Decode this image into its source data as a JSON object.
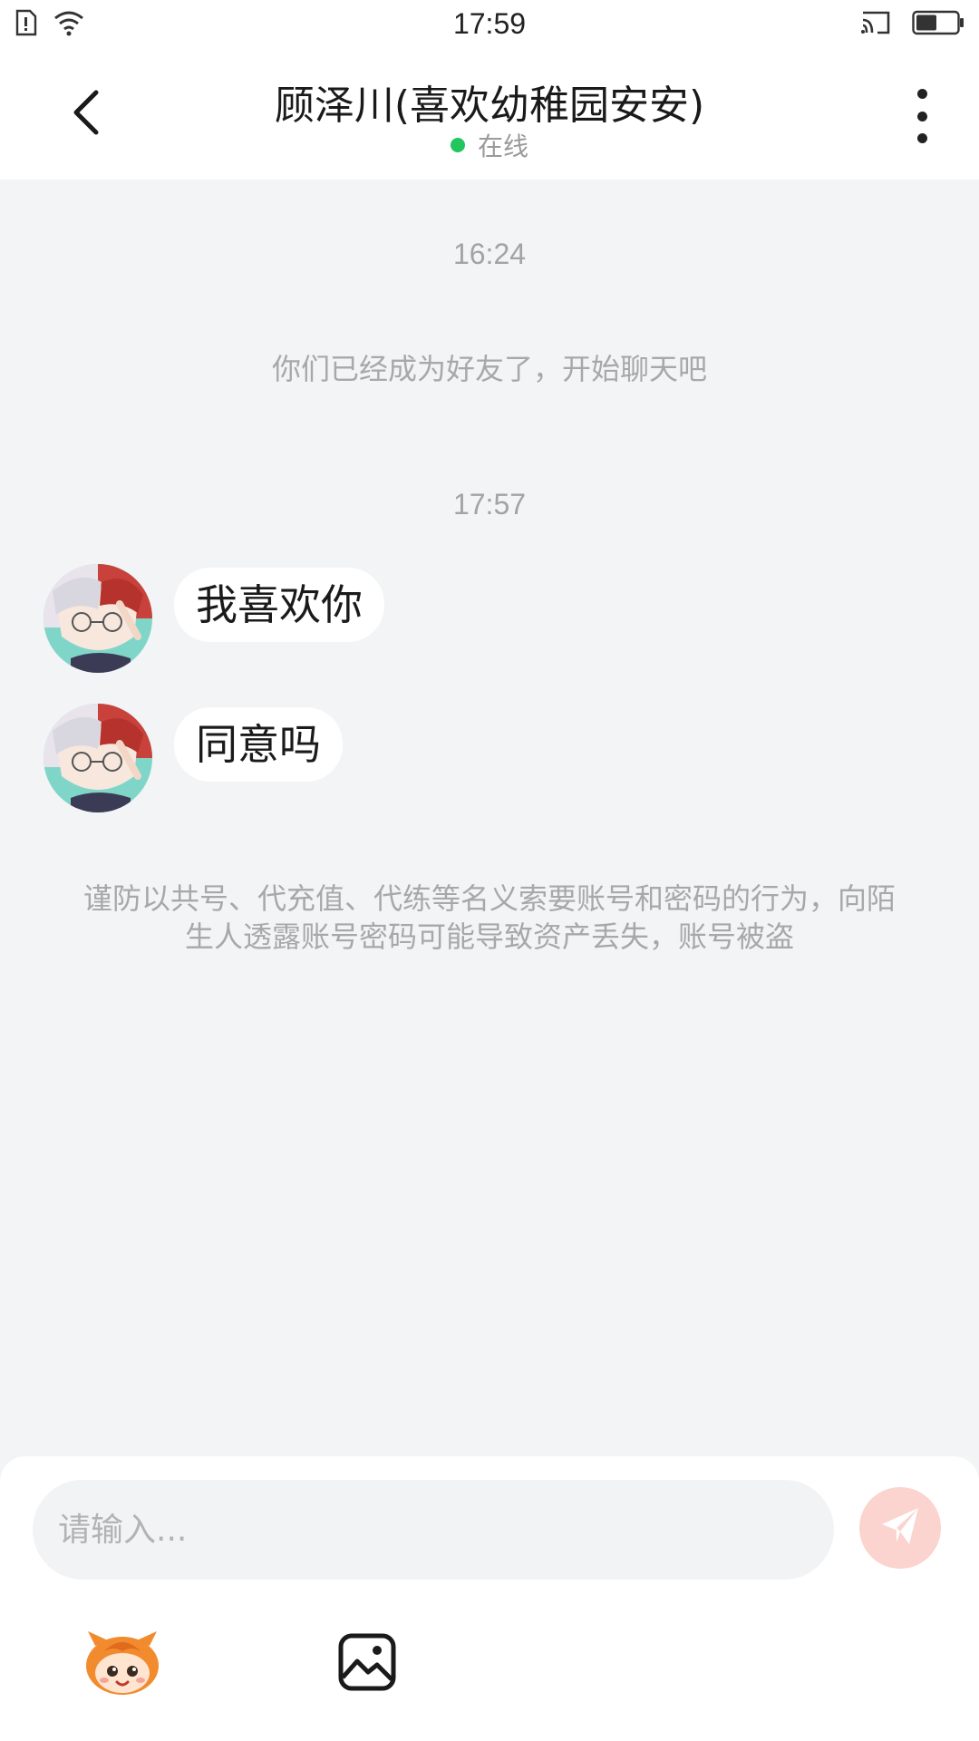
{
  "status_bar": {
    "time": "17:59",
    "icons": [
      "sim-alert-icon",
      "wifi-icon",
      "cast-icon",
      "battery-icon"
    ]
  },
  "header": {
    "title": "顾泽川(喜欢幼稚园安安)",
    "status_text": "在线",
    "status_color": "#22c55e",
    "icons": [
      "back-arrow-icon",
      "more-vertical-icon"
    ]
  },
  "chat": {
    "timestamp_1": "16:24",
    "system_message": "你们已经成为好友了，开始聊天吧",
    "timestamp_2": "17:57",
    "messages": [
      {
        "text": "我喜欢你",
        "avatar": "anime-avatar"
      },
      {
        "text": "同意吗",
        "avatar": "anime-avatar"
      }
    ],
    "warning": "谨防以共号、代充值、代练等名义索要账号和密码的行为，向陌生人透露账号密码可能导致资产丢失，账号被盗"
  },
  "composer": {
    "placeholder": "请输入...",
    "send_color": "#f7a39a",
    "icons": [
      "send-icon",
      "emoji-mascot-icon",
      "image-gallery-icon"
    ]
  }
}
